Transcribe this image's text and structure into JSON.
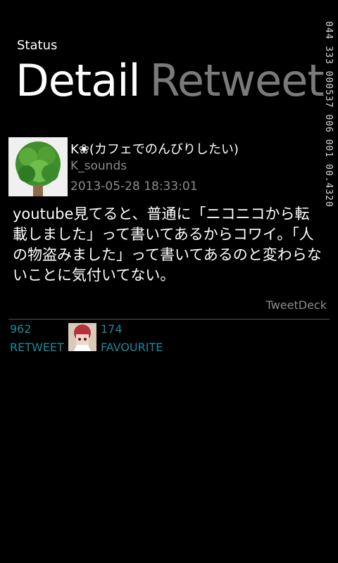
{
  "header": {
    "app_title": "Status",
    "tabs": [
      {
        "label": "Detail",
        "active": true
      },
      {
        "label": "Retweet",
        "active": false
      }
    ]
  },
  "side_readout": "044 333 000537 006 001 00.4320",
  "tweet": {
    "user_name": "K❀(カフェでのんびりしたい)",
    "screen_name": "K_sounds",
    "timestamp": "2013-05-28  18:33:01",
    "text": "youtube見てると、普通に「ニコニコから転載しました」って書いてあるからコワイ。「人の物盗みました」って書いてあるのと変わらないことに気付いてない。",
    "source": "TweetDeck",
    "retweet_count": "962",
    "retweet_label": "RETWEET",
    "favourite_count": "174",
    "favourite_label": "FAVOURITE"
  },
  "colors": {
    "background": "#000000",
    "accent": "#1a8a9c",
    "muted": "#8c8c8c",
    "inactive_tab": "#7a7a7a"
  }
}
